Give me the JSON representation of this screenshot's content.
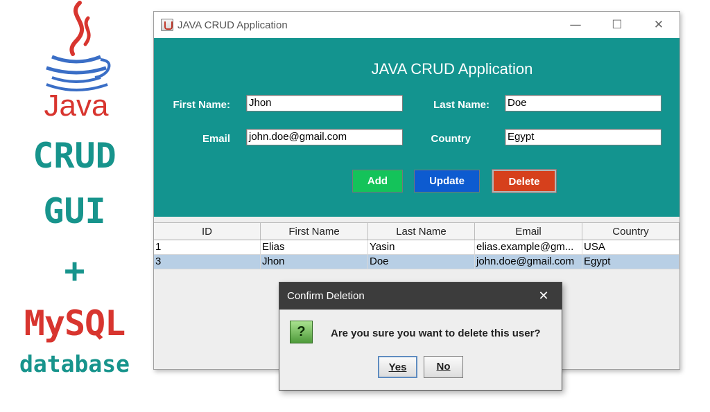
{
  "banner": {
    "logo_icon": "java-coffee-cup-icon",
    "java_wordmark": "Java",
    "line1": "CRUD",
    "line2": "GUI",
    "line3": "+",
    "line4": "MySQL",
    "line5": "database",
    "colors": {
      "teal": "#17948c",
      "red": "#d8352f",
      "blue": "#3a6ec6"
    }
  },
  "window": {
    "title": "JAVA CRUD Application",
    "controls": {
      "minimize": "—",
      "maximize": "☐",
      "close": "✕"
    }
  },
  "form": {
    "heading": "JAVA CRUD Application",
    "first_name_label": "First Name:",
    "first_name_value": "Jhon",
    "last_name_label": "Last Name:",
    "last_name_value": "Doe",
    "email_label": "Email",
    "email_value": "john.doe@gmail.com",
    "country_label": "Country",
    "country_value": "Egypt",
    "add_label": "Add",
    "update_label": "Update",
    "delete_label": "Delete",
    "colors": {
      "panel": "#13948f",
      "add": "#14c35a",
      "update": "#0d5bd0",
      "delete": "#d6401c"
    }
  },
  "table": {
    "headers": [
      "ID",
      "First Name",
      "Last Name",
      "Email",
      "Country"
    ],
    "rows": [
      [
        "1",
        "Elias",
        "Yasin",
        "elias.example@gm...",
        "USA"
      ],
      [
        "3",
        "Jhon",
        "Doe",
        "john.doe@gmail.com",
        "Egypt"
      ]
    ],
    "selected_row": 1,
    "selection_color": "#b8cfe5"
  },
  "dialog": {
    "title": "Confirm Deletion",
    "close_glyph": "✕",
    "icon": "question-icon",
    "icon_glyph": "?",
    "message": "Are you sure you want to delete this user?",
    "yes_label": "Yes",
    "no_label": "No"
  }
}
